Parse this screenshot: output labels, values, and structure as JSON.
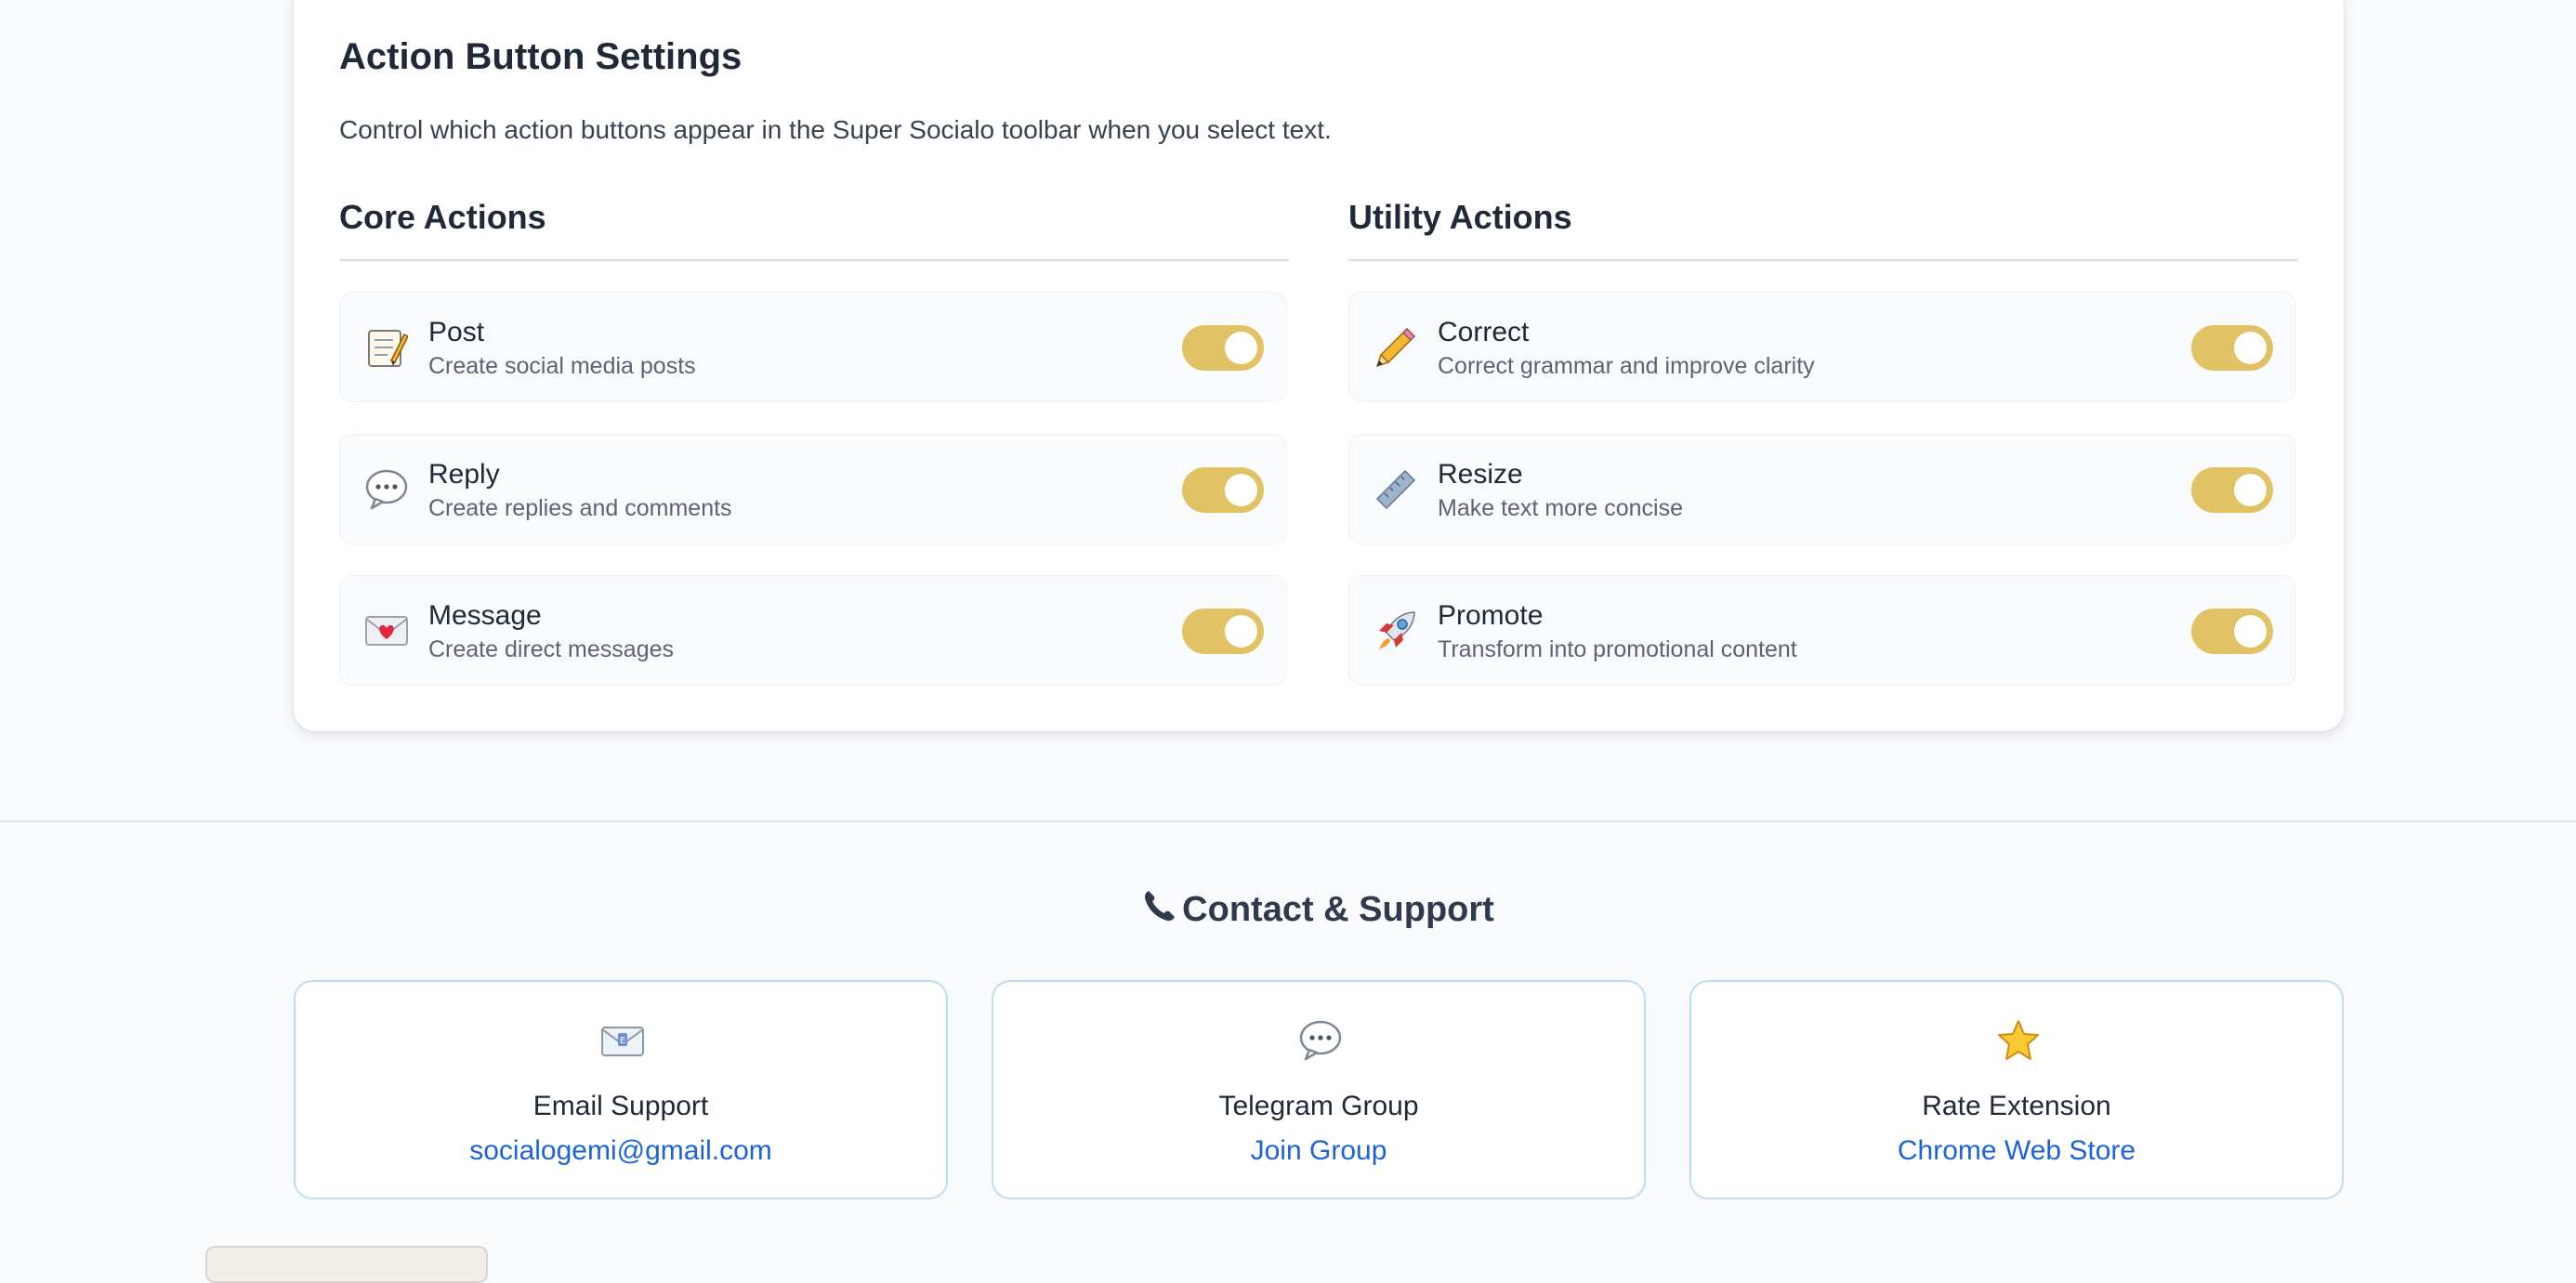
{
  "settings": {
    "title": "Action Button Settings",
    "description": "Control which action buttons appear in the Super Socialo toolbar when you select text."
  },
  "core_actions": {
    "heading": "Core Actions",
    "items": [
      {
        "label": "Post",
        "description": "Create social media posts",
        "icon": "memo-icon",
        "enabled": true
      },
      {
        "label": "Reply",
        "description": "Create replies and comments",
        "icon": "speech-bubble-icon",
        "enabled": true
      },
      {
        "label": "Message",
        "description": "Create direct messages",
        "icon": "love-letter-icon",
        "enabled": true
      }
    ]
  },
  "utility_actions": {
    "heading": "Utility Actions",
    "items": [
      {
        "label": "Correct",
        "description": "Correct grammar and improve clarity",
        "icon": "pencil-icon",
        "enabled": true
      },
      {
        "label": "Resize",
        "description": "Make text more concise",
        "icon": "ruler-icon",
        "enabled": true
      },
      {
        "label": "Promote",
        "description": "Transform into promotional content",
        "icon": "rocket-icon",
        "enabled": true
      }
    ]
  },
  "contact": {
    "title": "Contact & Support",
    "cards": [
      {
        "name": "Email Support",
        "link": "socialogemi@gmail.com",
        "icon": "envelope-icon"
      },
      {
        "name": "Telegram Group",
        "link": "Join Group",
        "icon": "speech-bubble-icon"
      },
      {
        "name": "Rate Extension",
        "link": "Chrome Web Store",
        "icon": "star-icon"
      }
    ]
  },
  "colors": {
    "toggle_on": "#e1c264",
    "link": "#1d63d8",
    "card_border": "#bfdcf6"
  }
}
